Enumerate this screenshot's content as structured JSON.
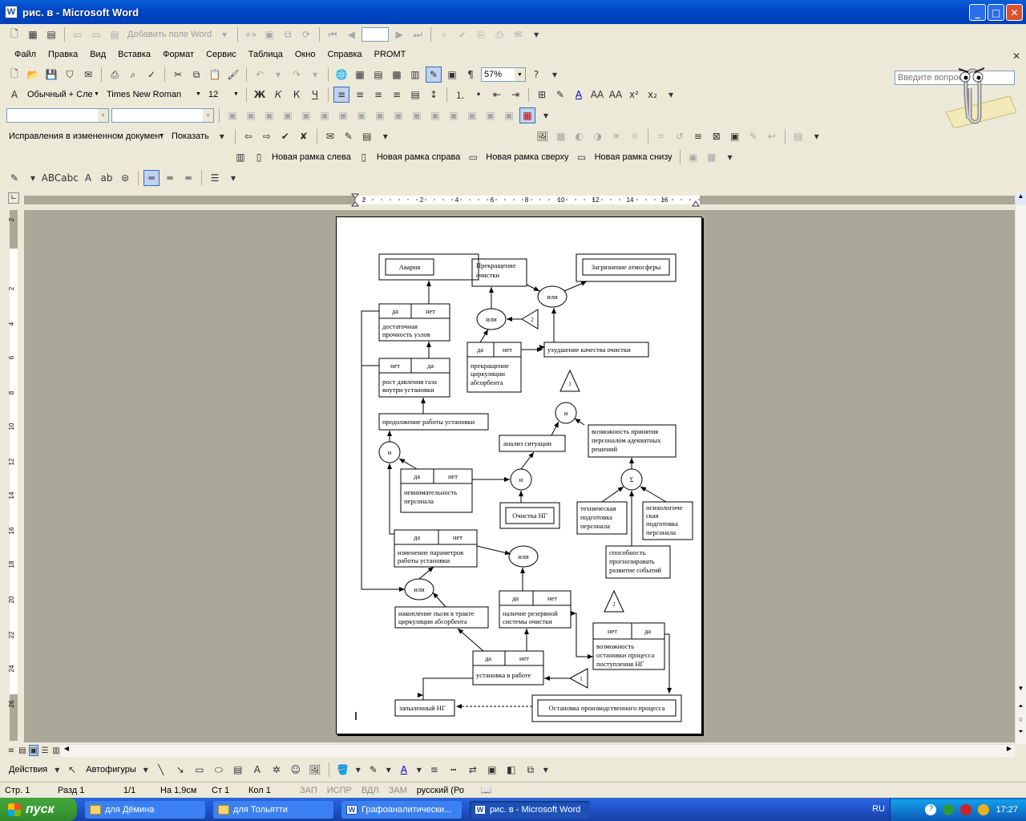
{
  "window": {
    "title": "рис. в - Microsoft Word",
    "app_icon": "W"
  },
  "menu": [
    "Файл",
    "Правка",
    "Вид",
    "Вставка",
    "Формат",
    "Сервис",
    "Таблица",
    "Окно",
    "Справка",
    "PROMT"
  ],
  "help_box": {
    "placeholder": "Введите вопрос"
  },
  "toolbar": {
    "add_field": "Добавить поле Word",
    "zoom": "57%",
    "style": "Обычный + Сле",
    "font": "Times New Roman",
    "size": "12",
    "reviewing": "Исправления в измененном документ",
    "show": "Показать",
    "frame_left": "Новая рамка слева",
    "frame_right": "Новая рамка справа",
    "frame_top": "Новая рамка сверху",
    "frame_bottom": "Новая рамка снизу"
  },
  "ruler": {
    "h_ticks": [
      "2",
      "2",
      "4",
      "6",
      "8",
      "10",
      "12",
      "14",
      "16"
    ],
    "v_ticks": [
      "2",
      "2",
      "4",
      "6",
      "8",
      "10",
      "12",
      "14",
      "16",
      "18",
      "20",
      "22",
      "24",
      "26"
    ]
  },
  "diagram": {
    "avaria": "Авария",
    "da": "да",
    "net": "нет",
    "ili": "или",
    "i": "и",
    "sum": "Σ",
    "prochnost": [
      "достаточная",
      "прочность узлов"
    ],
    "davlenie": [
      "рост давления газа",
      "внутри установки"
    ],
    "prodolzhenie": "продолжение работы установки",
    "prekrashchenie_ochistki": [
      "Прекращение",
      "очистки"
    ],
    "zagryaznenie": "Загрязнение атмосферы",
    "tri_2": "2",
    "tri_1": "1",
    "prekrashchenie_cirk": [
      "прекращение",
      "циркуляции",
      "абсорбента"
    ],
    "uhudshenie": "ухудшение качества очистки",
    "vozmozhnost_prinyatiya": [
      "возможность принятия",
      "персоналом адекватных",
      "решений"
    ],
    "analiz": "анализ ситуации",
    "nevnimatelnost": [
      "невнимательность",
      "персонала"
    ],
    "ochistka_ng": "Очистка НГ",
    "tehnicheskaya": [
      "техническая",
      "подготовка",
      "персонала"
    ],
    "psihologicheskaya": [
      "психологиче",
      "ская",
      "подготовка",
      "персонала"
    ],
    "sposobnost": [
      "способность",
      "прогнозировать",
      "развитие событий"
    ],
    "izmenenie": [
      "изменение параметров",
      "работы установки"
    ],
    "nakoplenie": [
      "накопление пыли в тракте",
      "циркуляции абсорбента"
    ],
    "rezervnoy": [
      "наличие резервной",
      "системы очистки"
    ],
    "ostanovki_processa": [
      "возможность",
      "остановки процесса",
      "поступления НГ"
    ],
    "ustanovka_v_rabote": "установка в работе",
    "zapylenny": "запыленный НГ",
    "ostanovka": "Остановка производственного процесса"
  },
  "drawing_toolbar": {
    "actions": "Действия",
    "autoshapes": "Автофигуры"
  },
  "status": {
    "page": "Стр. 1",
    "section": "Разд 1",
    "pages": "1/1",
    "at": "На 1,9см",
    "line": "Ст 1",
    "col": "Кол 1",
    "rec": "ЗАП",
    "trk": "ИСПР",
    "ext": "ВДЛ",
    "ovr": "ЗАМ",
    "lang": "русский (Ро"
  },
  "taskbar": {
    "start": "пуск",
    "tasks": [
      "для Дёмина",
      "для Тольятти",
      "Графоаналитически...",
      "рис. в - Microsoft Word"
    ],
    "lang": "RU",
    "clock": "17:27"
  }
}
